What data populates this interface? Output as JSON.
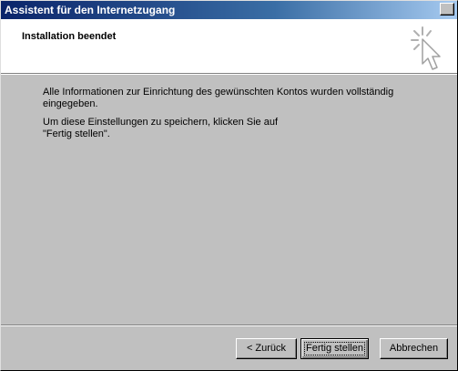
{
  "window": {
    "title": "Assistent für den Internetzugang"
  },
  "header": {
    "title": "Installation beendet",
    "icon": "wizard-cursor-sparkle-icon"
  },
  "body": {
    "paragraph1": "Alle Informationen zur Einrichtung des gewünschten Kontos wurden vollständig eingegeben.",
    "paragraph2": "Um diese Einstellungen zu speichern, klicken Sie auf \"Fertig stellen\"."
  },
  "buttons": {
    "back": "< Zurück",
    "finish": "Fertig stellen",
    "cancel": "Abbrechen"
  },
  "colors": {
    "titlebar_start": "#0a246a",
    "titlebar_end": "#a6caf0",
    "face": "#c0c0c0",
    "header_bg": "#ffffff"
  }
}
